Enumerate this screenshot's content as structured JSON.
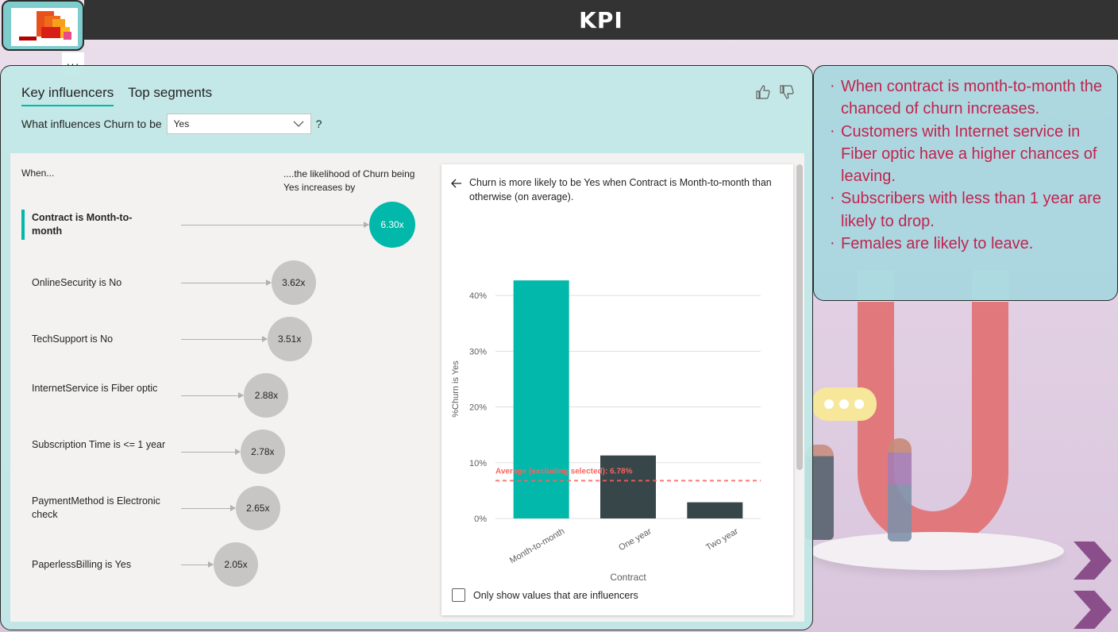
{
  "header": {
    "title": "KPI",
    "more_label": "···"
  },
  "visual": {
    "tabs": [
      {
        "label": "Key influencers",
        "active": true
      },
      {
        "label": "Top segments",
        "active": false
      }
    ],
    "question_prefix": "What influences Churn to be",
    "question_value": "Yes",
    "question_suffix": "?",
    "col_when": "When...",
    "col_likelihood": "....the likelihood of Churn being Yes increases by",
    "influencers": [
      {
        "label": "Contract is Month-to-month",
        "value": "6.30x",
        "multiplier": 6.3,
        "selected": true
      },
      {
        "label": "OnlineSecurity is No",
        "value": "3.62x",
        "multiplier": 3.62,
        "selected": false
      },
      {
        "label": "TechSupport is No",
        "value": "3.51x",
        "multiplier": 3.51,
        "selected": false
      },
      {
        "label": "InternetService is Fiber optic",
        "value": "2.88x",
        "multiplier": 2.88,
        "selected": false
      },
      {
        "label": "Subscription Time is <= 1 year",
        "value": "2.78x",
        "multiplier": 2.78,
        "selected": false
      },
      {
        "label": "PaymentMethod is Electronic check",
        "value": "2.65x",
        "multiplier": 2.65,
        "selected": false
      },
      {
        "label": "PaperlessBilling is Yes",
        "value": "2.05x",
        "multiplier": 2.05,
        "selected": false
      }
    ],
    "detail_text": "Churn is more likely to be Yes when Contract is Month-to-month than otherwise (on average).",
    "only_influencers_label": "Only show values that are influencers",
    "colors": {
      "accent": "#01b8aa",
      "dark_bar": "#374649",
      "average_line": "#fd625e",
      "bubble": "#c8c6c4"
    }
  },
  "chart_data": {
    "type": "bar",
    "categories": [
      "Month-to-month",
      "One year",
      "Two year"
    ],
    "values": [
      42.7,
      11.3,
      2.9
    ],
    "highlight": "Month-to-month",
    "xlabel": "Contract",
    "ylabel": "%Churn is Yes",
    "ylim": [
      0,
      45
    ],
    "yticks": [
      0,
      10,
      20,
      30,
      40
    ],
    "ytick_labels": [
      "0%",
      "10%",
      "20%",
      "30%",
      "40%"
    ],
    "average": 6.78,
    "average_label": "Average (excluding selected): 6.78%",
    "grid": true
  },
  "insights": [
    "When contract is month-to-month the chanced of churn increases.",
    "Customers with Internet service in Fiber optic have a higher chances of leaving.",
    "Subscribers with less than 1 year are likely to drop.",
    "Females are likely to leave."
  ]
}
